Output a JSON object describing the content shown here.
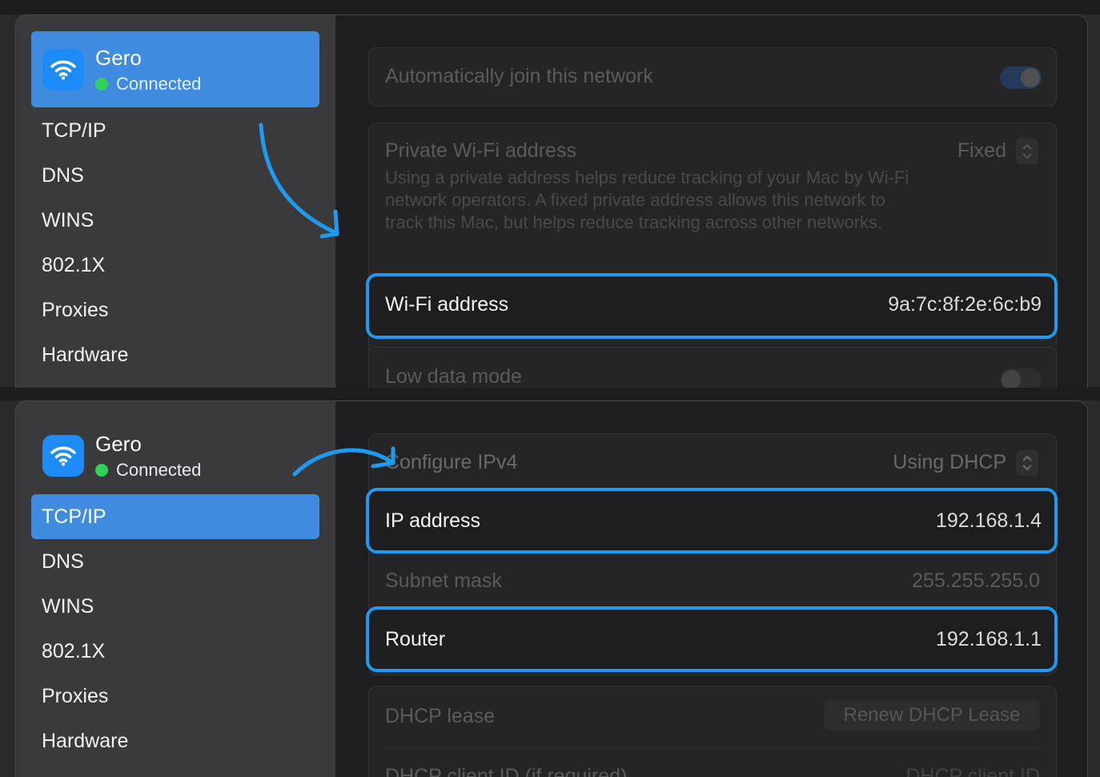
{
  "network": {
    "name": "Gero",
    "status": "Connected",
    "status_color": "#30d158",
    "icon": "wifi-icon"
  },
  "sidebar": {
    "items": [
      "TCP/IP",
      "DNS",
      "WINS",
      "802.1X",
      "Proxies",
      "Hardware"
    ]
  },
  "top_panel": {
    "auto_join_label": "Automatically join this network",
    "private_address_label": "Private Wi-Fi address",
    "private_address_value": "Fixed",
    "private_address_description": "Using a private address helps reduce tracking of your Mac by Wi-Fi network operators. A fixed private address allows this network to track this Mac, but helps reduce tracking across other networks.",
    "wifi_address_label": "Wi-Fi address",
    "wifi_address_value": "9a:7c:8f:2e:6c:b9",
    "low_data_label": "Low data mode"
  },
  "bottom_panel": {
    "configure_label": "Configure IPv4",
    "configure_value": "Using DHCP",
    "ip_label": "IP address",
    "ip_value": "192.168.1.4",
    "subnet_label": "Subnet mask",
    "subnet_value": "255.255.255.0",
    "router_label": "Router",
    "router_value": "192.168.1.1",
    "dhcp_lease_label": "DHCP lease",
    "renew_button": "Renew DHCP Lease",
    "client_id_label": "DHCP client ID (if required)",
    "client_id_placeholder": "DHCP client ID"
  },
  "colors": {
    "accent": "#3e8be0",
    "highlight": "#1e9bf0"
  }
}
